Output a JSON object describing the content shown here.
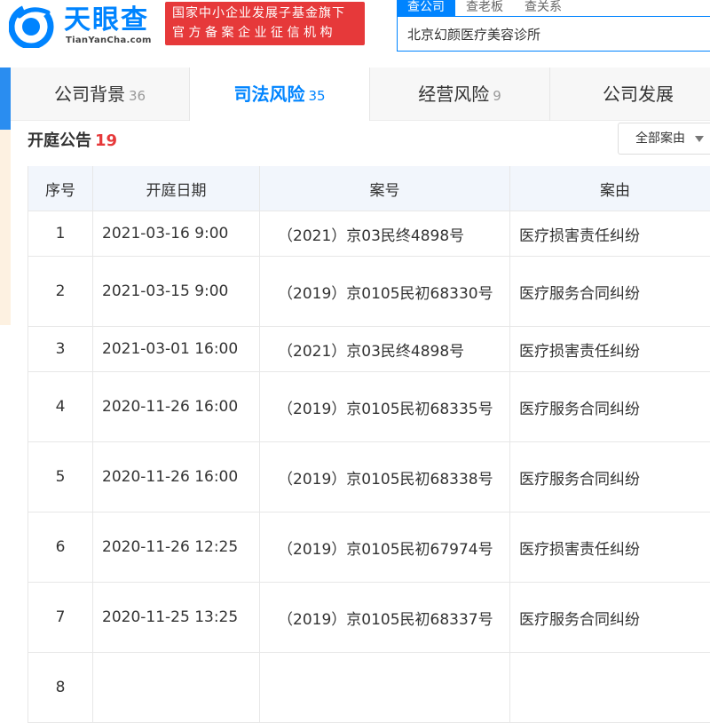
{
  "brand": {
    "name": "天眼查",
    "domain": "TianYanCha.com",
    "promo_line1": "国家中小企业发展子基金旗下",
    "promo_line2": "官方备案企业征信机构"
  },
  "search": {
    "tabs": [
      "查公司",
      "查老板",
      "查关系"
    ],
    "active_tab": 0,
    "query": "北京幻颜医疗美容诊所"
  },
  "section_tabs": [
    {
      "label": "公司背景",
      "count": "36"
    },
    {
      "label": "司法风险",
      "count": "35"
    },
    {
      "label": "经营风险",
      "count": "9"
    },
    {
      "label": "公司发展",
      "count": ""
    }
  ],
  "section": {
    "title": "开庭公告",
    "count": "19",
    "filter_label": "全部案由"
  },
  "table": {
    "headers": [
      "序号",
      "开庭日期",
      "案号",
      "案由"
    ],
    "rows": [
      {
        "no": "1",
        "date": "2021-03-16 9:00",
        "case": "（2021）京03民终4898号",
        "cause": "医疗损害责任纠纷"
      },
      {
        "no": "2",
        "date": "2021-03-15 9:00",
        "case": "（2019）京0105民初68330号",
        "cause": "医疗服务合同纠纷"
      },
      {
        "no": "3",
        "date": "2021-03-01 16:00",
        "case": "（2021）京03民终4898号",
        "cause": "医疗损害责任纠纷"
      },
      {
        "no": "4",
        "date": "2020-11-26 16:00",
        "case": "（2019）京0105民初68335号",
        "cause": "医疗服务合同纠纷"
      },
      {
        "no": "5",
        "date": "2020-11-26 16:00",
        "case": "（2019）京0105民初68338号",
        "cause": "医疗服务合同纠纷"
      },
      {
        "no": "6",
        "date": "2020-11-26 12:25",
        "case": "（2019）京0105民初67974号",
        "cause": "医疗损害责任纠纷"
      },
      {
        "no": "7",
        "date": "2020-11-25 13:25",
        "case": "（2019）京0105民初68337号",
        "cause": "医疗服务合同纠纷"
      },
      {
        "no": "8",
        "date": "",
        "case": "",
        "cause": ""
      }
    ]
  },
  "colors": {
    "brand_blue": "#0084ff",
    "promo_red": "#e6393a",
    "table_header_bg": "#f2f6fc"
  }
}
